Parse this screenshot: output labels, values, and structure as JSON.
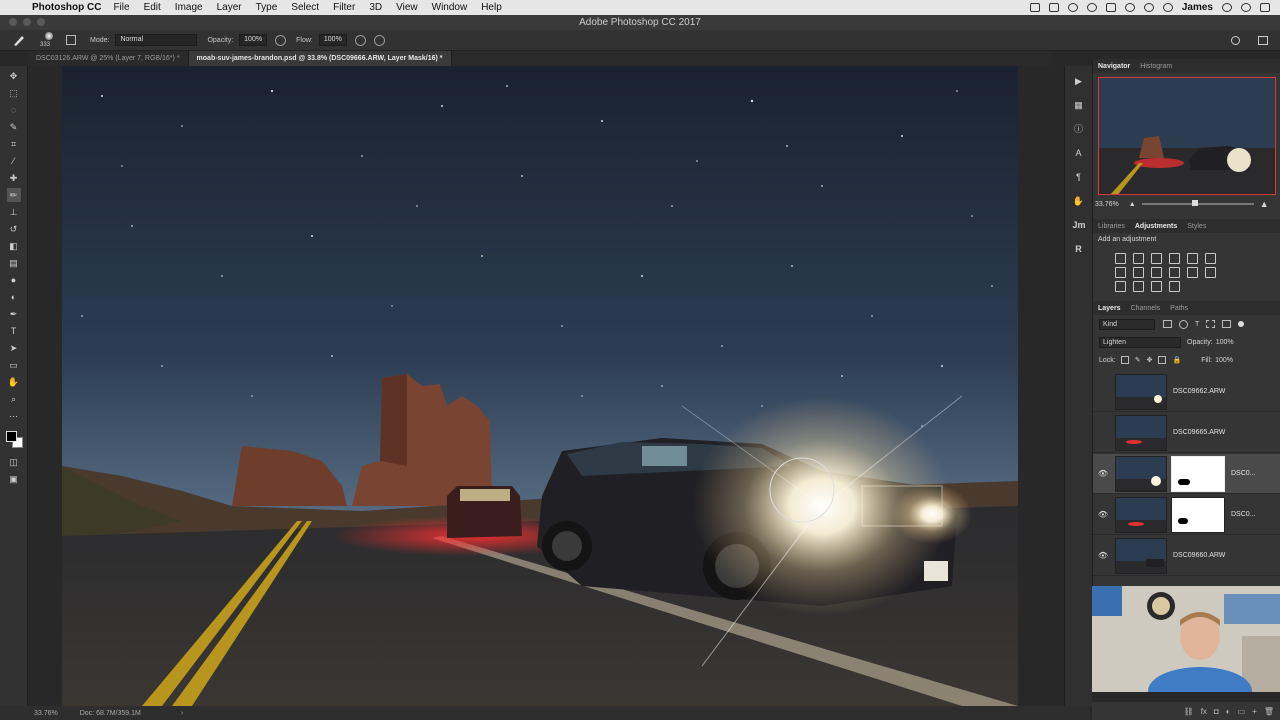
{
  "menubar": {
    "app_name": "Photoshop CC",
    "items": [
      "File",
      "Edit",
      "Image",
      "Layer",
      "Type",
      "Select",
      "Filter",
      "3D",
      "View",
      "Window",
      "Help"
    ],
    "user": "James"
  },
  "window": {
    "title": "Adobe Photoshop CC 2017"
  },
  "options": {
    "brush_size": "333",
    "mode_label": "Mode:",
    "mode_value": "Normal",
    "opacity_label": "Opacity:",
    "opacity_value": "100%",
    "flow_label": "Flow:",
    "flow_value": "100%"
  },
  "tabs": [
    {
      "label": "DSC03126.ARW @ 25% (Layer 7, RGB/16*) *",
      "active": false
    },
    {
      "label": "moab-suv-james-brandon.psd @ 33.8% (DSC09666.ARW, Layer Mask/16) *",
      "active": true
    }
  ],
  "status": {
    "zoom": "33.76%",
    "doc": "Doc: 68.7M/359.1M"
  },
  "navigator": {
    "tabs": [
      "Navigator",
      "Histogram"
    ],
    "zoom": "33.76%"
  },
  "adjustments": {
    "tabs": [
      "Libraries",
      "Adjustments",
      "Styles"
    ],
    "add_label": "Add an adjustment"
  },
  "layers_panel": {
    "tabs": [
      "Layers",
      "Channels",
      "Paths"
    ],
    "kind_label": "Kind",
    "blend_mode": "Lighten",
    "opacity_label": "Opacity:",
    "opacity_value": "100%",
    "lock_label": "Lock:",
    "fill_label": "Fill:",
    "fill_value": "100%",
    "layers": [
      {
        "name": "DSC09662.ARW",
        "visible": false,
        "mask": false
      },
      {
        "name": "DSC09665.ARW",
        "visible": false,
        "mask": false
      },
      {
        "name": "DSC0...",
        "visible": true,
        "mask": true,
        "selected": true
      },
      {
        "name": "DSC0...",
        "visible": true,
        "mask": true
      },
      {
        "name": "DSC09660.ARW",
        "visible": true,
        "mask": false
      }
    ]
  },
  "colors": {
    "accent_red": "#d43a3a",
    "ui_dark": "#323232",
    "sky_top": "#1a2230",
    "sky_bottom": "#5a6f86"
  }
}
